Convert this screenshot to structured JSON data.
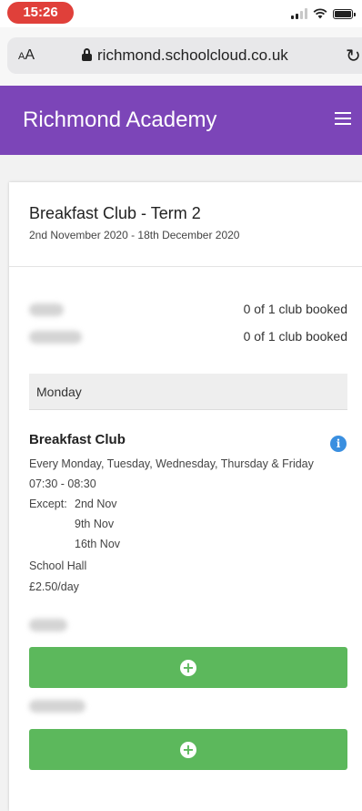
{
  "status_bar": {
    "time": "15:26"
  },
  "browser": {
    "aa_label": "AA",
    "url": "richmond.schoolcloud.co.uk"
  },
  "header": {
    "title": "Richmond Academy"
  },
  "card": {
    "title": "Breakfast Club - Term 2",
    "dates": "2nd November 2020 - 18th December 2020",
    "bookings": [
      {
        "status": "0 of 1 club booked"
      },
      {
        "status": "0 of 1 club booked"
      }
    ],
    "day": "Monday",
    "club": {
      "name": "Breakfast Club",
      "schedule": "Every Monday, Tuesday, Wednesday, Thursday & Friday",
      "time": "07:30 - 08:30",
      "except_label": "Except:",
      "except_dates": [
        "2nd Nov",
        "9th Nov",
        "16th Nov"
      ],
      "location": "School Hall",
      "price": "£2.50/day"
    }
  }
}
